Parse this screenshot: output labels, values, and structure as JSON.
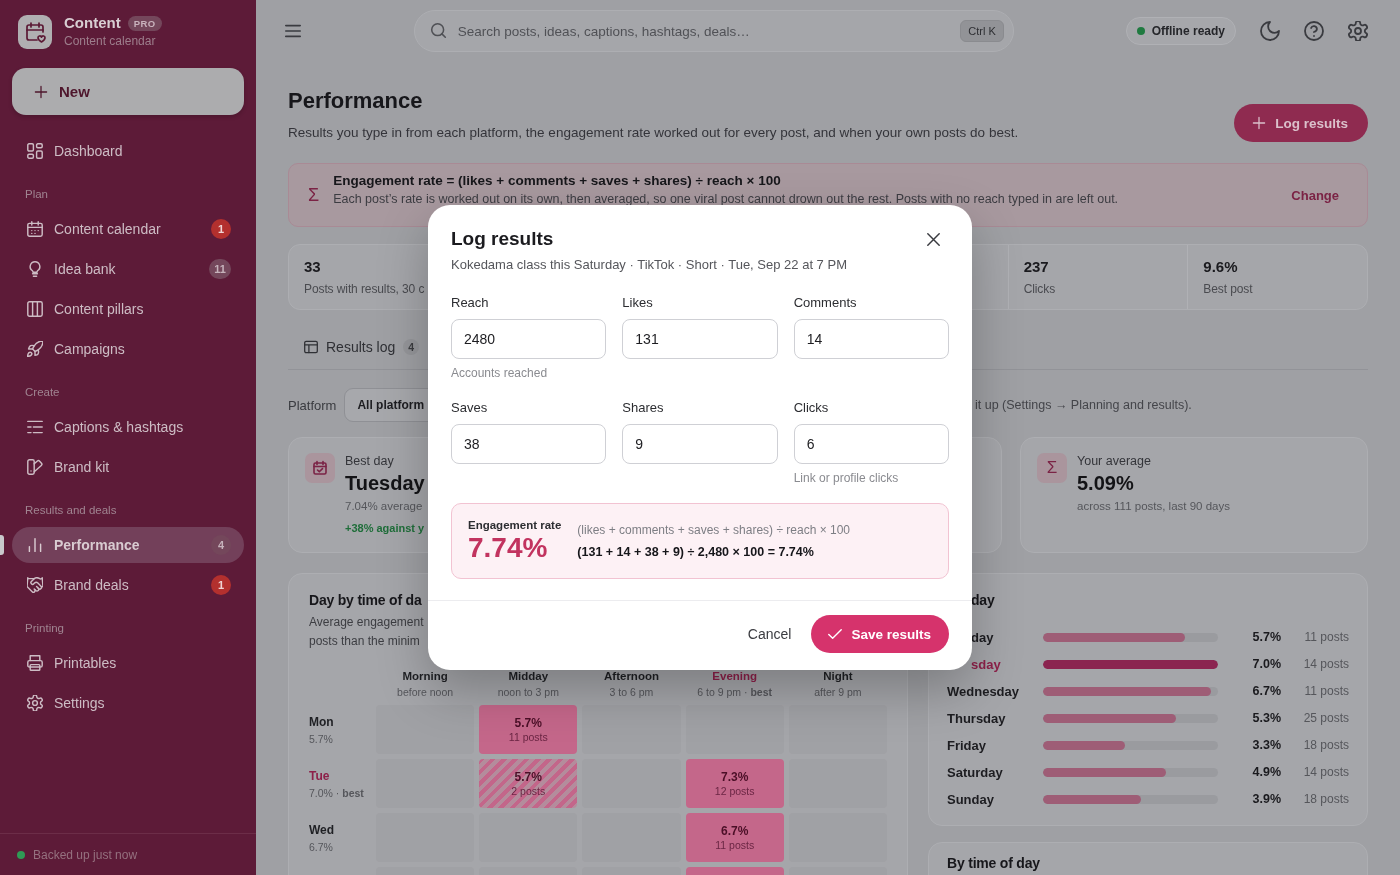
{
  "sidebar": {
    "brand": {
      "name": "Content",
      "badge": "PRO",
      "subtitle": "Content calendar"
    },
    "new_button": "New",
    "groups": [
      {
        "items": [
          {
            "label": "Dashboard",
            "selected": false
          }
        ]
      },
      {
        "title": "Plan",
        "items": [
          {
            "label": "Content calendar",
            "selected": false,
            "badge": {
              "text": "1",
              "alert": true
            }
          },
          {
            "label": "Idea bank",
            "selected": false,
            "badge": {
              "text": "11",
              "alert": false
            }
          },
          {
            "label": "Content pillars",
            "selected": false
          },
          {
            "label": "Campaigns",
            "selected": false
          }
        ]
      },
      {
        "title": "Create",
        "items": [
          {
            "label": "Captions & hashtags",
            "selected": false
          },
          {
            "label": "Brand kit",
            "selected": false
          }
        ]
      },
      {
        "title": "Results and deals",
        "items": [
          {
            "label": "Performance",
            "selected": true,
            "badge": {
              "text": "4",
              "alert": false
            }
          },
          {
            "label": "Brand deals",
            "selected": false,
            "badge": {
              "text": "1",
              "alert": true
            }
          }
        ]
      },
      {
        "title": "Printing",
        "items": [
          {
            "label": "Printables",
            "selected": false
          },
          {
            "label": "Settings",
            "selected": false
          }
        ]
      }
    ],
    "backup_status": "Backed up just now"
  },
  "topbar": {
    "search": {
      "placeholder": "Search posts, ideas, captions, hashtags, deals…",
      "shortcut": "Ctrl K"
    },
    "status": "Offline ready"
  },
  "header": {
    "title": "Performance",
    "subtitle": "Results you type in from each platform, the engagement rate worked out for every post, and when your own posts do best.",
    "button": "Log results"
  },
  "formula_banner": {
    "symbol": "Σ",
    "title": "Engagement rate = (likes + comments + saves + shares) ÷ reach × 100",
    "text": "Each post’s rate is worked out on its own, then averaged, so one viral post cannot drown out the rest. Posts with no reach typed in are left out.",
    "action": "Change"
  },
  "stats": [
    {
      "value": "33",
      "label": "Posts with results, 30 c"
    },
    {
      "value": "237",
      "label": "Clicks"
    },
    {
      "value": "9.6%",
      "label": "Best post"
    }
  ],
  "tabs": [
    {
      "label": "Results log",
      "count": "4",
      "selected": false
    }
  ],
  "filter": {
    "label": "Platform",
    "value": "All platform",
    "note": "it up (Settings → Planning and results)."
  },
  "insight_cards": [
    {
      "label": "Best day",
      "value": "Tuesday",
      "detail": "7.04% average",
      "delta": "+38% against y"
    },
    {
      "symbol": "Σ",
      "label": "Your average",
      "value": "5.09%",
      "detail": "across 111 posts, last 90 days"
    }
  ],
  "heatmap": {
    "title": "Day by time of da",
    "description_lines": [
      "Average engagement",
      "posts than the minim"
    ],
    "columns": [
      {
        "name": "Morning",
        "hint": "before noon",
        "best": false
      },
      {
        "name": "Midday",
        "hint": "noon to 3 pm",
        "best": false
      },
      {
        "name": "Afternoon",
        "hint": "3 to 6 pm",
        "best": false
      },
      {
        "name": "Evening",
        "hint": "6 to 9 pm · **best**",
        "best": true
      },
      {
        "name": "Night",
        "hint": "after 9 pm",
        "best": false
      }
    ],
    "rows": [
      {
        "day": "Mon",
        "average": "5.7%",
        "best": false,
        "cells": [
          {
            "kind": "empty"
          },
          {
            "kind": "value",
            "value": "5.7%",
            "posts": "11 posts"
          },
          {
            "kind": "empty"
          },
          {
            "kind": "empty"
          },
          {
            "kind": "empty"
          }
        ]
      },
      {
        "day": "Tue",
        "average": "7.0% · **best**",
        "best": true,
        "cells": [
          {
            "kind": "empty"
          },
          {
            "kind": "few",
            "value": "5.7%",
            "posts": "2 posts"
          },
          {
            "kind": "empty"
          },
          {
            "kind": "value",
            "value": "7.3%",
            "posts": "12 posts"
          },
          {
            "kind": "empty"
          }
        ]
      },
      {
        "day": "Wed",
        "average": "6.7%",
        "best": false,
        "cells": [
          {
            "kind": "empty"
          },
          {
            "kind": "empty"
          },
          {
            "kind": "empty"
          },
          {
            "kind": "value",
            "value": "6.7%",
            "posts": "11 posts"
          },
          {
            "kind": "empty"
          }
        ]
      },
      {
        "cells": [
          {
            "kind": "empty"
          },
          {
            "kind": "empty"
          },
          {
            "kind": "empty"
          },
          {
            "kind": "value"
          },
          {
            "kind": "empty"
          }
        ]
      }
    ]
  },
  "by_day": {
    "title": "day",
    "title_cut_by_dialog": true,
    "rows": [
      {
        "day": "day",
        "cut_by_dialog": true,
        "best": false,
        "level": 0.81,
        "rate": "5.7%",
        "posts": "11 posts"
      },
      {
        "day": "sday",
        "cut_by_dialog": true,
        "best": true,
        "level": 1,
        "rate": "7.0%",
        "posts": "14 posts"
      },
      {
        "day": "Wednesday",
        "best": false,
        "level": 0.96,
        "rate": "6.7%",
        "posts": "11 posts"
      },
      {
        "day": "Thursday",
        "best": false,
        "level": 0.76,
        "rate": "5.3%",
        "posts": "25 posts"
      },
      {
        "day": "Friday",
        "best": false,
        "level": 0.47,
        "rate": "3.3%",
        "posts": "18 posts"
      },
      {
        "day": "Saturday",
        "best": false,
        "level": 0.7,
        "rate": "4.9%",
        "posts": "14 posts"
      },
      {
        "day": "Sunday",
        "best": false,
        "level": 0.56,
        "rate": "3.9%",
        "posts": "18 posts"
      }
    ]
  },
  "by_time": {
    "title": "By time of day"
  },
  "dialog": {
    "title": "Log results",
    "subtitle": "Kokedama class this Saturday · TikTok · Short · Tue, Sep 22 at 7 PM",
    "fields": [
      {
        "label": "Reach",
        "value": "2480",
        "help": "Accounts reached"
      },
      {
        "label": "Likes",
        "value": "131"
      },
      {
        "label": "Comments",
        "value": "14"
      },
      {
        "label": "Saves",
        "value": "38"
      },
      {
        "label": "Shares",
        "value": "9"
      },
      {
        "label": "Clicks",
        "value": "6",
        "help": "Link or profile clicks"
      }
    ],
    "result": {
      "label": "Engagement rate",
      "value": "7.74%",
      "formula": "(likes + comments + saves + shares) ÷ reach × 100",
      "calculation": "(131 + 14 + 38 + 9) ÷ 2,480 × 100 = 7.74%"
    },
    "buttons": [
      {
        "label": "Cancel",
        "kind": "secondary"
      },
      {
        "label": "Save results",
        "kind": "primary"
      }
    ]
  }
}
